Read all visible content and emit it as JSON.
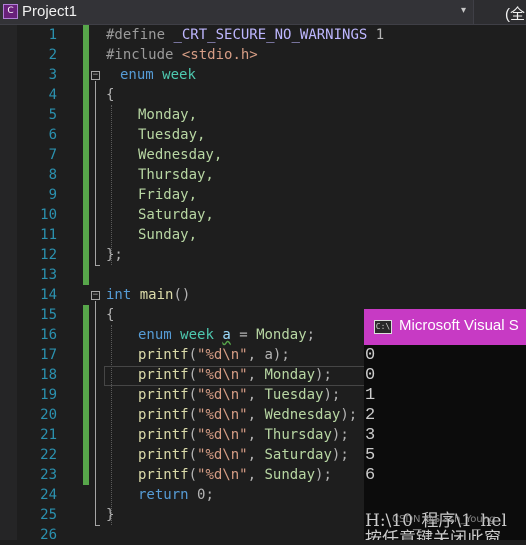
{
  "toolbar": {
    "project_icon_glyph": "C",
    "project_name": "Project1",
    "dropdown_chevron": "▾",
    "scope_text": "(全"
  },
  "editor": {
    "line_numbers": [
      "1",
      "2",
      "3",
      "4",
      "5",
      "6",
      "7",
      "8",
      "9",
      "10",
      "11",
      "12",
      "13",
      "14",
      "15",
      "16",
      "17",
      "18",
      "19",
      "20",
      "21",
      "22",
      "23",
      "24",
      "25",
      "26"
    ],
    "fold_collapse_glyph": "−",
    "code": {
      "l1_define": "#define",
      "l1_macro": "_CRT_SECURE_NO_WARNINGS",
      "l1_value": "1",
      "l2_include": "#include",
      "l2_header": "<stdio.h>",
      "l3_enum": "enum",
      "l3_name": "week",
      "l4_brace": "{",
      "l5": "Monday,",
      "l6": "Tuesday,",
      "l7": "Wednesday,",
      "l8": "Thursday,",
      "l9": "Friday,",
      "l10": "Saturday,",
      "l11": "Sunday,",
      "l12": "};",
      "l14_int": "int",
      "l14_main": "main",
      "l14_parens": "()",
      "l15_brace": "{",
      "l16_enum": "enum",
      "l16_week": "week",
      "l16_var": "a",
      "l16_eq": "=",
      "l16_val": "Monday",
      "l16_semi": ";",
      "printf": "printf",
      "fmt": "\"%d\\n\"",
      "l17_arg": "a",
      "l18_arg": "Monday",
      "l19_arg": "Tuesday",
      "l20_arg": "Wednesday",
      "l21_arg": "Thursday",
      "l22_arg": "Saturday",
      "l23_arg": "Sunday",
      "open_paren": "(",
      "comma": ",",
      "close": ");",
      "l24_return": "return",
      "l24_val": "0;",
      "l25_brace": "}"
    }
  },
  "console": {
    "icon_glyph": "C:\\",
    "title": "Microsoft Visual S",
    "output": [
      "0",
      "0",
      "1",
      "2",
      "3",
      "5",
      "6"
    ],
    "path_line": "H:\\10_程序\\1_hel",
    "prompt_line": "按任意键关闭此窗"
  },
  "watermark": "CSDN @Slash_Young"
}
